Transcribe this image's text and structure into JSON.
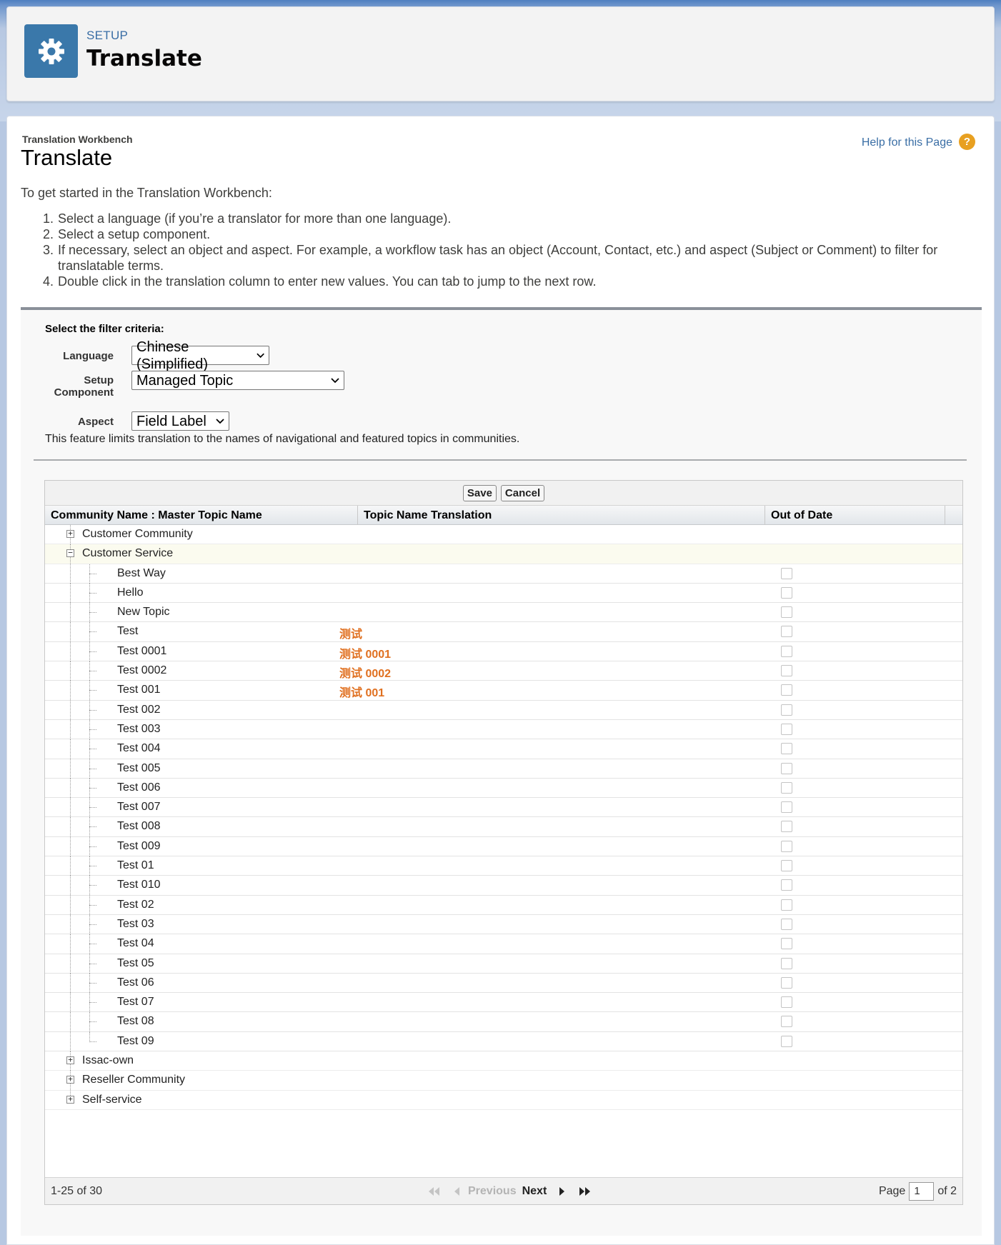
{
  "header": {
    "setup_label": "SETUP",
    "title": "Translate"
  },
  "page": {
    "workbench_label": "Translation Workbench",
    "title": "Translate",
    "help_link": "Help for this Page",
    "help_icon": "?",
    "intro": "To get started in the Translation Workbench:",
    "steps": [
      {
        "num": "1.",
        "text": "Select a language (if you’re a translator for more than one language)."
      },
      {
        "num": "2.",
        "text": "Select a setup component."
      },
      {
        "num": "3.",
        "text": "If necessary, select an object and aspect. For example, a workflow task has an object (Account, Contact, etc.) and aspect (Subject or Comment) to filter for translatable terms."
      },
      {
        "num": "4.",
        "text": "Double click in the translation column to enter new values. You can tab to jump to the next row."
      }
    ]
  },
  "filter": {
    "title": "Select the filter criteria:",
    "language_label": "Language",
    "language_value": "Chinese (Simplified)",
    "component_label_1": "Setup",
    "component_label_2": "Component",
    "component_value": "Managed Topic",
    "aspect_label": "Aspect",
    "aspect_value": "Field Label",
    "note": "This feature limits translation to the names of navigational and featured topics in communities."
  },
  "table": {
    "save_label": "Save",
    "cancel_label": "Cancel",
    "columns": [
      "Community Name : Master Topic Name",
      "Topic Name Translation",
      "Out of Date"
    ],
    "parents_before": [
      {
        "name": "Customer Community",
        "toggle": "+"
      }
    ],
    "expanded_parent": {
      "name": "Customer Service",
      "toggle": "−"
    },
    "children": [
      {
        "name": "Best Way",
        "translation": ""
      },
      {
        "name": "Hello",
        "translation": ""
      },
      {
        "name": "New Topic",
        "translation": ""
      },
      {
        "name": "Test",
        "translation": "测试"
      },
      {
        "name": "Test 0001",
        "translation": "测试 0001"
      },
      {
        "name": "Test 0002",
        "translation": "测试 0002"
      },
      {
        "name": "Test 001",
        "translation": "测试 001"
      },
      {
        "name": "Test 002",
        "translation": ""
      },
      {
        "name": "Test 003",
        "translation": ""
      },
      {
        "name": "Test 004",
        "translation": ""
      },
      {
        "name": "Test 005",
        "translation": ""
      },
      {
        "name": "Test 006",
        "translation": ""
      },
      {
        "name": "Test 007",
        "translation": ""
      },
      {
        "name": "Test 008",
        "translation": ""
      },
      {
        "name": "Test 009",
        "translation": ""
      },
      {
        "name": "Test 01",
        "translation": ""
      },
      {
        "name": "Test 010",
        "translation": ""
      },
      {
        "name": "Test 02",
        "translation": ""
      },
      {
        "name": "Test 03",
        "translation": ""
      },
      {
        "name": "Test 04",
        "translation": ""
      },
      {
        "name": "Test 05",
        "translation": ""
      },
      {
        "name": "Test 06",
        "translation": ""
      },
      {
        "name": "Test 07",
        "translation": ""
      },
      {
        "name": "Test 08",
        "translation": ""
      },
      {
        "name": "Test 09",
        "translation": ""
      }
    ],
    "parents_after": [
      {
        "name": "Issac-own",
        "toggle": "+"
      },
      {
        "name": "Reseller Community",
        "toggle": "+"
      },
      {
        "name": "Self-service",
        "toggle": "+"
      }
    ],
    "translation_color": "#e07020"
  },
  "pager": {
    "range": "1-25 of 30",
    "first_icon": "double-chevron-left-icon",
    "prev_icon": "triangle-left-icon",
    "previous_label": "Previous",
    "next_label": "Next",
    "next_icon": "triangle-right-icon",
    "last_icon": "double-chevron-right-icon",
    "page_label": "Page",
    "page_value": "1",
    "of_label": "of 2"
  },
  "colors": {
    "brand_blue": "#3a78aa",
    "link_blue": "#3a6ea5",
    "help_orange": "#e8a020"
  }
}
